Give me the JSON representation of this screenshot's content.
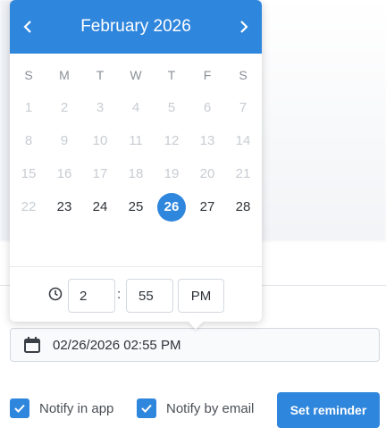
{
  "calendar": {
    "month_title": "February 2026",
    "weekdays": [
      "S",
      "M",
      "T",
      "W",
      "T",
      "F",
      "S"
    ],
    "days": [
      "1",
      "2",
      "3",
      "4",
      "5",
      "6",
      "7",
      "8",
      "9",
      "10",
      "11",
      "12",
      "13",
      "14",
      "15",
      "16",
      "17",
      "18",
      "19",
      "20",
      "21",
      "22",
      "23",
      "24",
      "25",
      "26",
      "27",
      "28"
    ],
    "enabled_days": [
      "23",
      "24",
      "25",
      "26",
      "27",
      "28"
    ],
    "selected_day": "26"
  },
  "time": {
    "hour": "2",
    "separator": ":",
    "minute": "55",
    "period": "PM"
  },
  "datetime_field": {
    "value": "02/26/2026 02:55 PM",
    "icon": "calendar-icon"
  },
  "options": {
    "notify_app_label": "Notify in app",
    "notify_app_checked": true,
    "notify_email_label": "Notify by email",
    "notify_email_checked": true
  },
  "actions": {
    "submit_label": "Set reminder"
  },
  "colors": {
    "accent": "#2f86dd",
    "disabled_text": "#c8ccd1",
    "text": "#2f3338"
  }
}
